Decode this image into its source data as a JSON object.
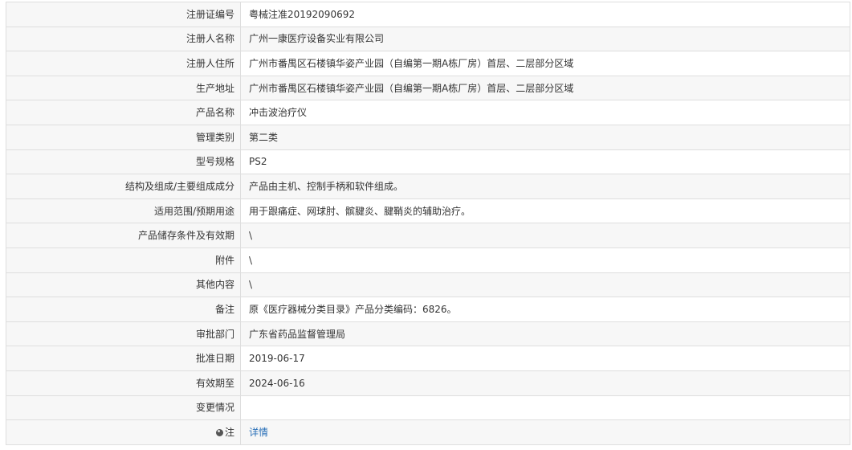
{
  "rows": [
    {
      "label": "注册证编号",
      "value": "粤械注准20192090692"
    },
    {
      "label": "注册人名称",
      "value": "广州一康医疗设备实业有限公司"
    },
    {
      "label": "注册人住所",
      "value": "广州市番禺区石楼镇华姿产业园（自编第一期A栋厂房）首层、二层部分区域"
    },
    {
      "label": "生产地址",
      "value": "广州市番禺区石楼镇华姿产业园（自编第一期A栋厂房）首层、二层部分区域"
    },
    {
      "label": "产品名称",
      "value": "冲击波治疗仪"
    },
    {
      "label": "管理类别",
      "value": "第二类"
    },
    {
      "label": "型号规格",
      "value": "PS2"
    },
    {
      "label": "结构及组成/主要组成成分",
      "value": "产品由主机、控制手柄和软件组成。"
    },
    {
      "label": "适用范围/预期用途",
      "value": "用于跟痛症、网球肘、髌腱炎、腱鞘炎的辅助治疗。"
    },
    {
      "label": "产品储存条件及有效期",
      "value": "\\"
    },
    {
      "label": "附件",
      "value": "\\"
    },
    {
      "label": "其他内容",
      "value": "\\"
    },
    {
      "label": "备注",
      "value": "原《医疗器械分类目录》产品分类编码：6826。"
    },
    {
      "label": "审批部门",
      "value": "广东省药品监督管理局"
    },
    {
      "label": "批准日期",
      "value": "2019-06-17"
    },
    {
      "label": "有效期至",
      "value": "2024-06-16"
    },
    {
      "label": "变更情况",
      "value": ""
    }
  ],
  "note": {
    "label": "注",
    "link_text": "详情",
    "icon": "pin-icon"
  },
  "colors": {
    "border": "#dedede",
    "label_bg": "#f7f7f7",
    "text": "#333333",
    "link": "#2a70b8"
  }
}
